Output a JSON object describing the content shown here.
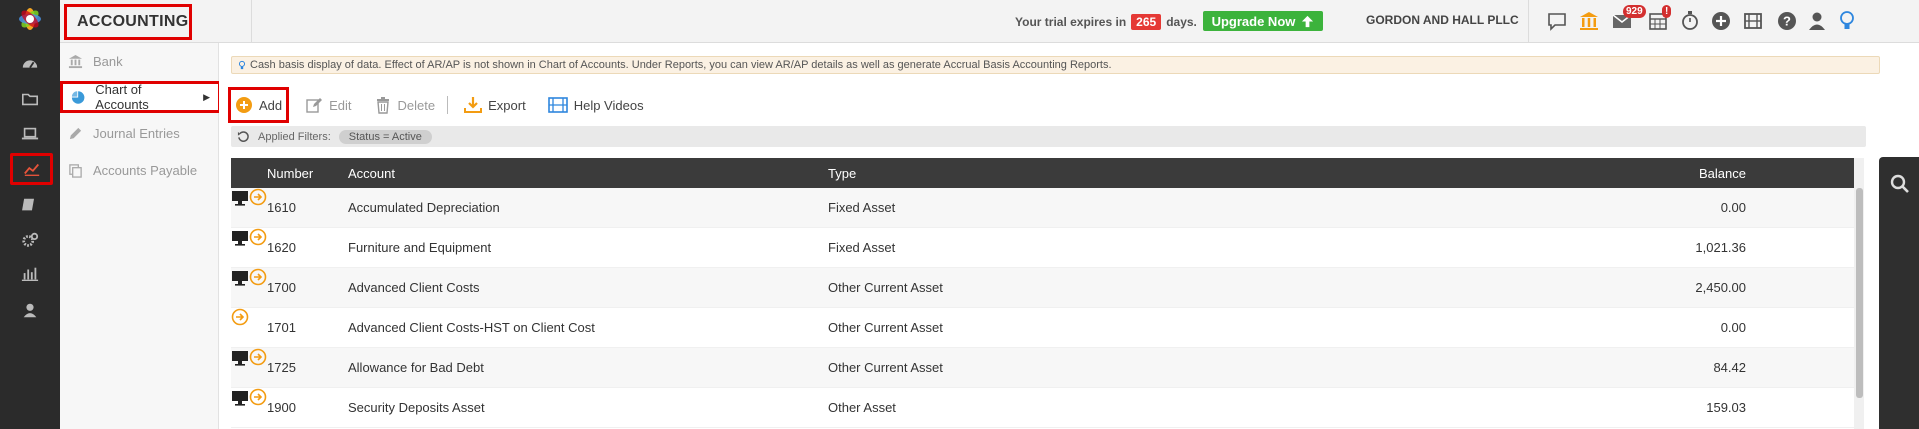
{
  "header": {
    "module_title": "ACCOUNTING",
    "trial_prefix": "Your trial expires in",
    "trial_days": "265",
    "trial_suffix": "days.",
    "upgrade_label": "Upgrade Now",
    "firm_name": "GORDON AND HALL PLLC",
    "mail_badge": "929",
    "calendar_badge": "!",
    "icons": [
      "chat-icon",
      "bank-icon",
      "mail-icon",
      "calendar-icon",
      "timer-icon",
      "add-circle-icon",
      "video-icon",
      "help-icon",
      "user-icon",
      "lightbulb-icon"
    ]
  },
  "rail": {
    "items": [
      "dashboard-icon",
      "folder-icon",
      "laptop-icon",
      "chart-line-icon",
      "book-icon",
      "settings-icon",
      "reports-icon",
      "person-icon"
    ],
    "active": "chart-line-icon"
  },
  "subnav": {
    "items": [
      {
        "label": "Bank",
        "icon": "bank-icon",
        "active": false
      },
      {
        "label": "Chart of Accounts",
        "icon": "pie-chart-icon",
        "active": true
      },
      {
        "label": "Journal Entries",
        "icon": "pencil-icon",
        "active": false
      },
      {
        "label": "Accounts Payable",
        "icon": "copy-icon",
        "active": false
      }
    ]
  },
  "info_text": "Cash basis display of data. Effect of AR/AP is not shown in Chart of Accounts. Under Reports, you can view AR/AP details as well as generate Accrual Basis Accounting Reports.",
  "toolbar": {
    "add": "Add",
    "edit": "Edit",
    "delete": "Delete",
    "export": "Export",
    "help_videos": "Help Videos"
  },
  "filters": {
    "label": "Applied Filters:",
    "chip": "Status = Active"
  },
  "grid": {
    "columns": {
      "number": "Number",
      "account": "Account",
      "type": "Type",
      "balance": "Balance"
    },
    "rows": [
      {
        "number": "1610",
        "account": "Accumulated Depreciation",
        "type": "Fixed Asset",
        "balance": "0.00",
        "has_icon": true
      },
      {
        "number": "1620",
        "account": "Furniture and Equipment",
        "type": "Fixed Asset",
        "balance": "1,021.36",
        "has_icon": true
      },
      {
        "number": "1700",
        "account": "Advanced Client Costs",
        "type": "Other Current Asset",
        "balance": "2,450.00",
        "has_icon": true
      },
      {
        "number": "1701",
        "account": "Advanced Client Costs-HST on Client Cost",
        "type": "Other Current Asset",
        "balance": "0.00",
        "has_icon": false
      },
      {
        "number": "1725",
        "account": "Allowance for Bad Debt",
        "type": "Other Current Asset",
        "balance": "84.42",
        "has_icon": true
      },
      {
        "number": "1900",
        "account": "Security Deposits Asset",
        "type": "Other Asset",
        "balance": "159.03",
        "has_icon": true
      }
    ]
  },
  "colors": {
    "highlight": "#e00000",
    "accent_orange": "#f39c12",
    "upgrade_green": "#3cb33c",
    "header_dark": "#3b3b3b"
  }
}
